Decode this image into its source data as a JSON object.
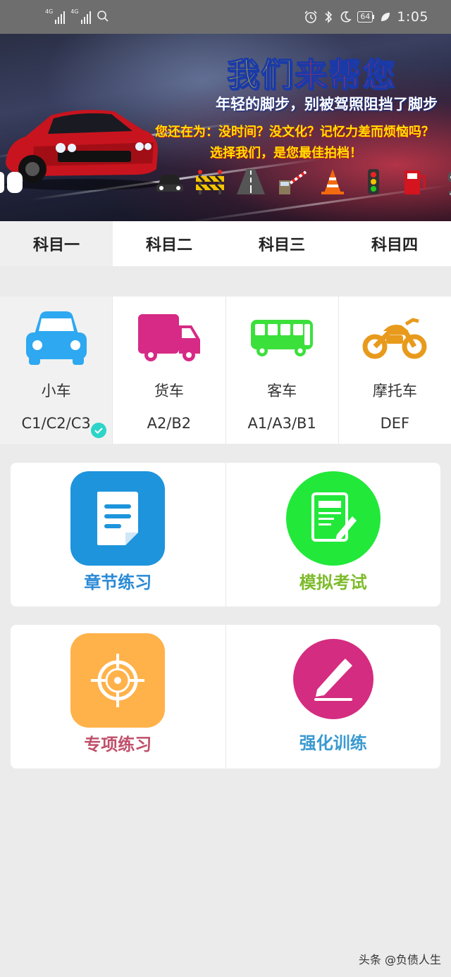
{
  "status_bar": {
    "signal1": "4G",
    "signal2": "4G",
    "battery": "64",
    "time": "1:05"
  },
  "banner": {
    "title_a": "我们",
    "title_b": "来帮您",
    "subtitle": "年轻的脚步，别被驾照阻挡了脚步",
    "line2": "您还在为：没时间？没文化？记忆力差而烦恼吗？",
    "line3": "选择我们，是您最佳拍档！"
  },
  "tabs": [
    {
      "label": "科目一"
    },
    {
      "label": "科目二"
    },
    {
      "label": "科目三"
    },
    {
      "label": "科目四"
    }
  ],
  "vehicles": [
    {
      "name": "小车",
      "class": "C1/C2/C3",
      "icon": "car-icon",
      "color": "#2ea8f0"
    },
    {
      "name": "货车",
      "class": "A2/B2",
      "icon": "truck-icon",
      "color": "#d62a86"
    },
    {
      "name": "客车",
      "class": "A1/A3/B1",
      "icon": "bus-icon",
      "color": "#3be03b"
    },
    {
      "name": "摩托车",
      "class": "DEF",
      "icon": "motorcycle-icon",
      "color": "#e89a1c"
    }
  ],
  "menu": [
    {
      "label": "章节练习",
      "color": "#2a8ad6",
      "icon": "document-icon",
      "bg": "#1e94dc"
    },
    {
      "label": "模拟考试",
      "color": "#7dbb2a",
      "icon": "exam-icon",
      "bg": "#22e83a"
    },
    {
      "label": "专项练习",
      "color": "#c0506a",
      "icon": "target-icon",
      "bg": "#ffb24a"
    },
    {
      "label": "强化训练",
      "color": "#3a9ad0",
      "icon": "pen-icon",
      "bg": "#d42c80"
    }
  ],
  "watermark": "头条 @负债人生"
}
